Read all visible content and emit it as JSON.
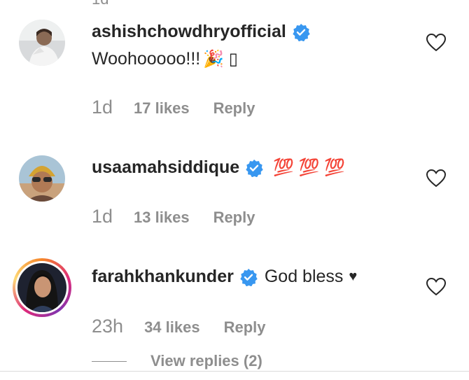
{
  "top_partial_time": "1d",
  "comments": [
    {
      "username": "ashishchowdhryofficial",
      "text": "Woohooooo!!!",
      "emoji": "🎉 ▯",
      "time": "1d",
      "likes": "17 likes",
      "reply": "Reply"
    },
    {
      "username": "usaamahsiddique",
      "text": "",
      "emoji": "💯 💯 💯",
      "time": "1d",
      "likes": "13 likes",
      "reply": "Reply"
    },
    {
      "username": "farahkhankunder",
      "text": "God bless",
      "emoji": "♥",
      "time": "23h",
      "likes": "34 likes",
      "reply": "Reply"
    }
  ],
  "view_replies": "View replies (2)",
  "colors": {
    "verified": "#3897f0",
    "secondary_text": "#8e8e8e",
    "primary_text": "#262626"
  }
}
